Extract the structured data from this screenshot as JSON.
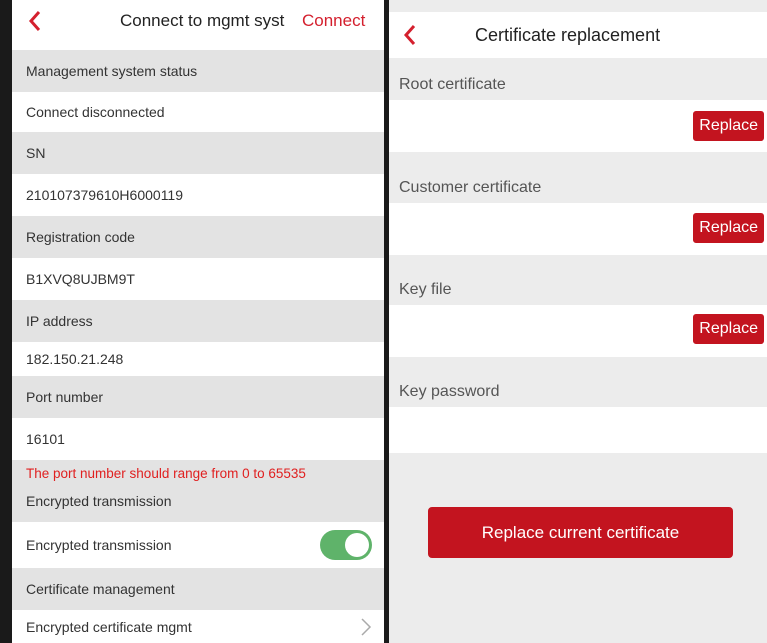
{
  "left": {
    "header": {
      "title": "Connect to mgmt syst",
      "action": "Connect"
    },
    "rows": {
      "mgmt_status_label": "Management system status",
      "connect_status": "Connect disconnected",
      "sn_label": "SN",
      "sn_value": "210107379610H6000119",
      "reg_label": "Registration code",
      "reg_value": "B1XVQ8UJBM9T",
      "ip_label": "IP address",
      "ip_value": "182.150.21.248",
      "port_label": "Port number",
      "port_value": "16101",
      "port_warning": "The port number should range from 0 to 65535",
      "enc_section": "Encrypted transmission",
      "enc_toggle_label": "Encrypted transmission",
      "cert_section": "Certificate management",
      "cert_item": "Encrypted certificate mgmt"
    },
    "toggle_on": true
  },
  "right": {
    "header": {
      "title": "Certificate replacement"
    },
    "root_label": "Root certificate",
    "customer_label": "Customer certificate",
    "keyfile_label": "Key file",
    "keypass_label": "Key password",
    "replace_label": "Replace",
    "main_button": "Replace current certificate"
  },
  "colors": {
    "accent": "#c3141f",
    "toggle": "#5fb36a",
    "warning": "#e02020"
  },
  "icons": {
    "back": "chevron-left-icon",
    "nav": "chevron-right-icon"
  }
}
